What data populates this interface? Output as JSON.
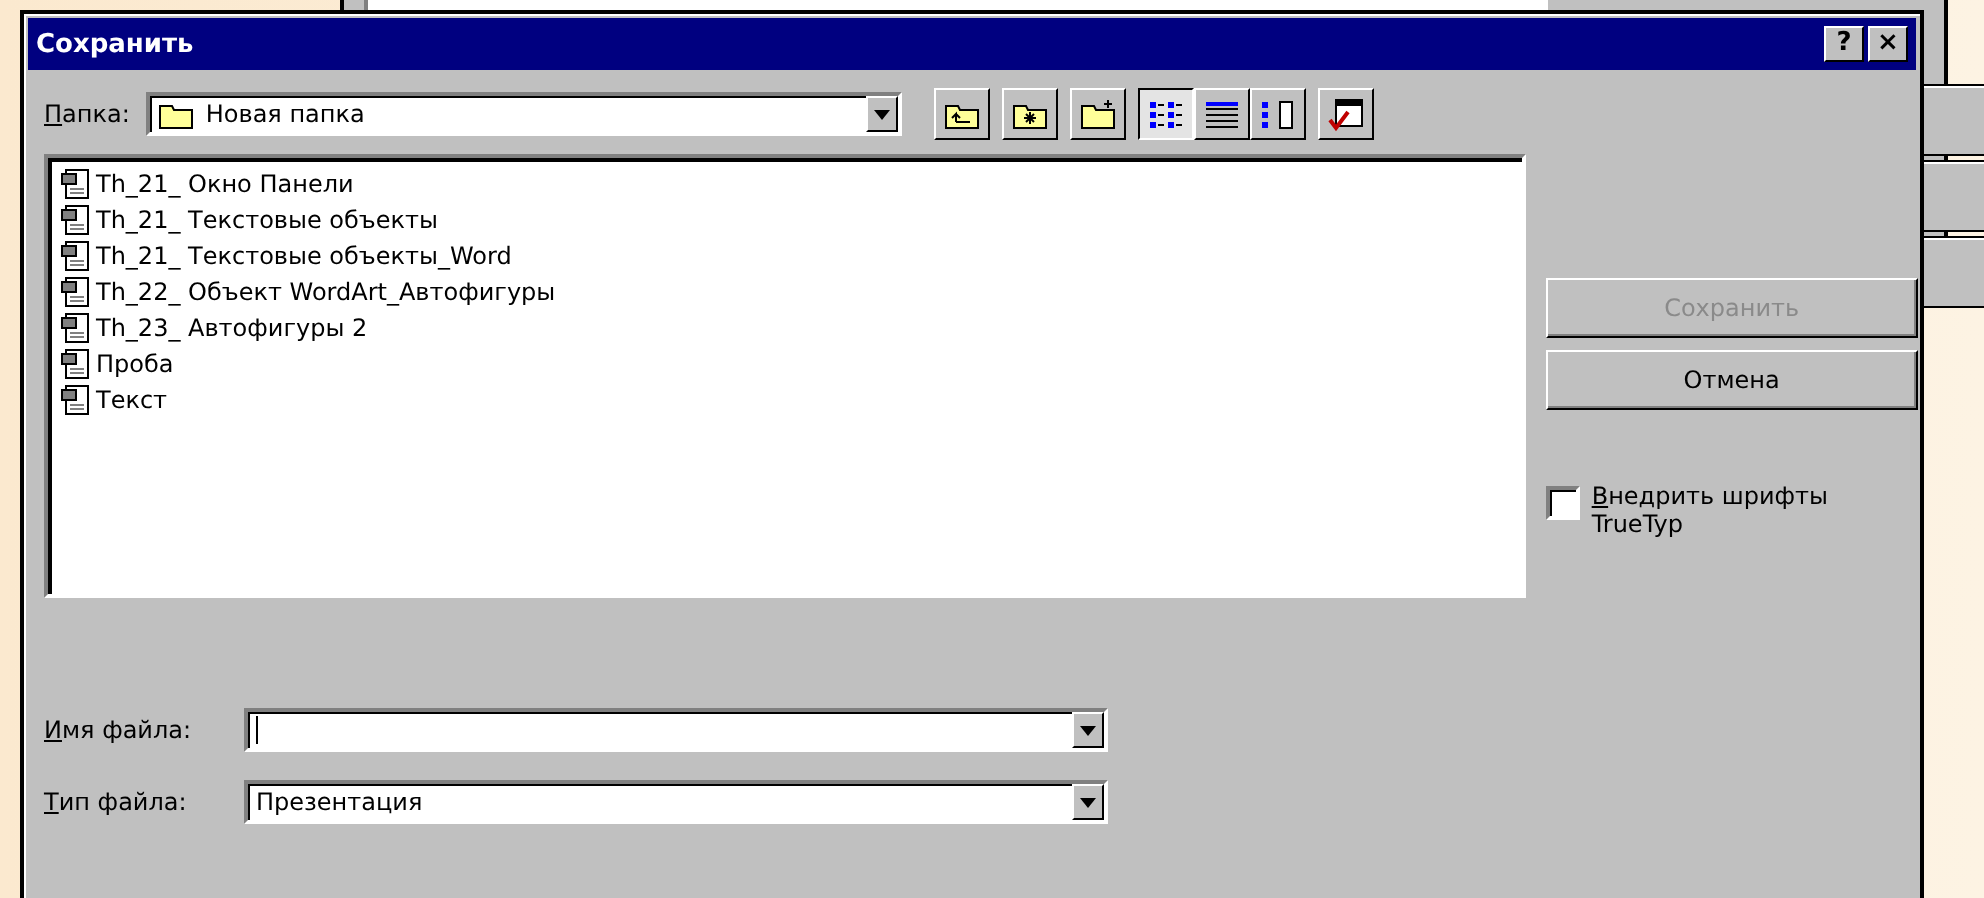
{
  "dialog": {
    "title": "Сохранить",
    "title_buttons": [
      "?",
      "×"
    ]
  },
  "folder": {
    "label": "Папка:",
    "value": "Новая папка"
  },
  "toolbar": [
    {
      "kind": "up",
      "selected": false
    },
    {
      "kind": "favorites",
      "selected": false
    },
    {
      "kind": "new-folder",
      "selected": false
    },
    {
      "kind": "list",
      "selected": true
    },
    {
      "kind": "details",
      "selected": false
    },
    {
      "kind": "properties",
      "selected": false
    },
    {
      "kind": "tools",
      "selected": false
    }
  ],
  "files": [
    "Th_21_ Окно Панели",
    "Th_21_ Текстовые объекты",
    "Th_21_ Текстовые объекты_Word",
    "Th_22_ Объект WordArt_Автофигуры",
    "Th_23_ Автофигуры 2",
    "Проба",
    "Текст"
  ],
  "buttons": [
    {
      "label": "Сохранить",
      "disabled": true
    },
    {
      "label": "Отмена",
      "disabled": false
    }
  ],
  "embed_fonts": {
    "label": "Внедрить шрифты TrueTyp",
    "checked": false
  },
  "file_name": {
    "label": "Имя файла:"
  },
  "file_type": {
    "label": "Тип файла:",
    "value": "Презентация"
  }
}
